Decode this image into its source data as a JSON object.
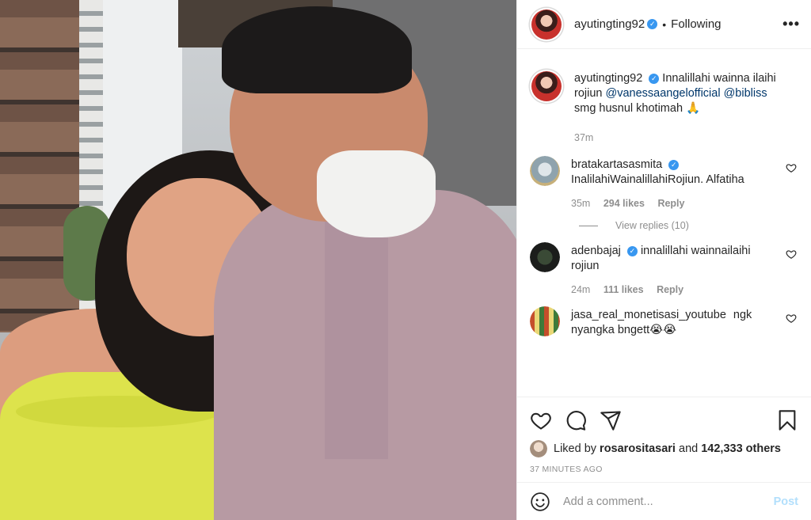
{
  "post": {
    "photo_alt": ""
  },
  "header": {
    "username": "ayutingting92",
    "verified_mark": "✓",
    "separator": "•",
    "follow_status": "Following",
    "more_label": "•••"
  },
  "caption": {
    "username": "ayutingting92",
    "verified_mark": "✓",
    "text_before": "Innalillahi wainna ilaihi rojiun ",
    "mention1": "@vanessaangelofficial",
    "mention2": "@bibliss",
    "text_after": "smg husnul khotimah 🙏",
    "time": "37m"
  },
  "comments": [
    {
      "username": "bratakartasasmita",
      "verified_mark": "✓",
      "text": "InalilahiWainalillahiRojiun. Alfatiha",
      "time": "35m",
      "likes": "294 likes",
      "reply_label": "Reply"
    },
    {
      "username": "adenbajaj",
      "verified_mark": "✓",
      "text": "innalillahi wainnailaihi rojiun",
      "time": "24m",
      "likes": "111 likes",
      "reply_label": "Reply"
    },
    {
      "username": "jasa_real_monetisasi_youtube",
      "text": "ngk nyangka bngett😭😭"
    }
  ],
  "view_replies": "View replies (10)",
  "likes": {
    "prefix": "Liked by ",
    "user": "rosarositasari",
    "middle": " and ",
    "count": "142,333 others"
  },
  "time_ago": "37 MINUTES AGO",
  "add_comment": {
    "placeholder": "Add a comment...",
    "post_label": "Post"
  },
  "icons": {
    "more": "more-icon",
    "heart": "heart-icon",
    "comment": "comment-icon",
    "share": "share-icon",
    "save": "bookmark-icon",
    "emoji": "emoji-icon",
    "verified": "verified-badge-icon"
  },
  "colors": {
    "verified": "#3897f0",
    "mention": "#00376b",
    "secondary_text": "#8e8e8e",
    "post_disabled": "#b2dffc",
    "divider": "#efefef"
  }
}
